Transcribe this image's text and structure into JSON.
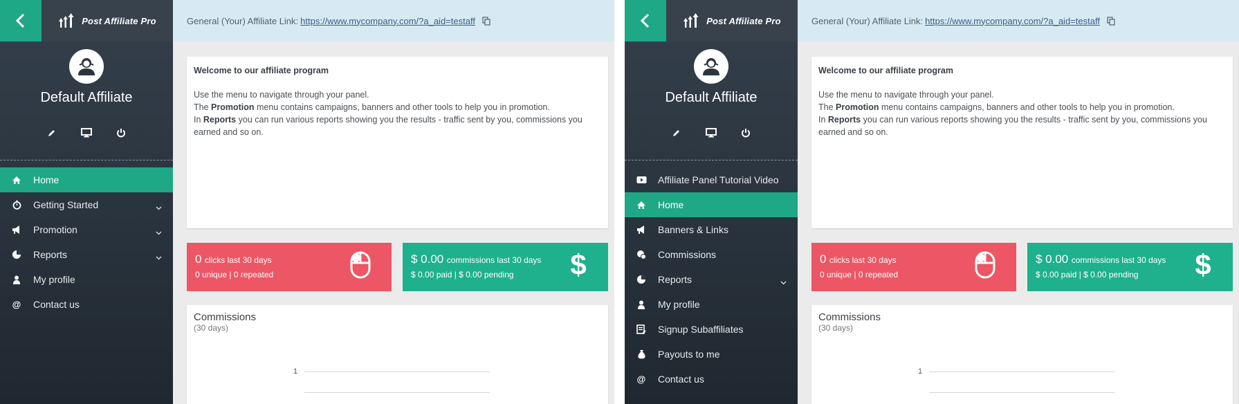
{
  "brand": "Post Affiliate Pro",
  "user_name": "Default Affiliate",
  "link_bar": {
    "label": "General (Your) Affiliate Link:",
    "url": "https://www.mycompany.com/?a_aid=testaff"
  },
  "welcome": {
    "title": "Welcome to our affiliate program",
    "line1": "Use the menu to navigate through your panel.",
    "line2_pre": "The ",
    "line2_bold": "Promotion",
    "line2_post": " menu contains campaigns, banners and other tools to help you in promotion.",
    "line3_pre": "In ",
    "line3_bold": "Reports",
    "line3_post": " you can run various reports showing you the results - traffic sent by you, commissions you earned and so on."
  },
  "stats": {
    "clicks_value": "0",
    "clicks_label": "clicks last 30 days",
    "clicks_sub": "0 unique | 0 repeated",
    "comm_value": "$ 0.00",
    "comm_label": "commissions last 30 days",
    "comm_sub": "$ 0.00 paid | $ 0.00 pending"
  },
  "commissions": {
    "title": "Commissions",
    "subtitle": "(30 days)",
    "tick": "1"
  },
  "left_nav": [
    {
      "label": "Home",
      "icon": "home-icon",
      "active": true,
      "chevron": false
    },
    {
      "label": "Getting Started",
      "icon": "stopwatch-icon",
      "active": false,
      "chevron": true
    },
    {
      "label": "Promotion",
      "icon": "megaphone-icon",
      "active": false,
      "chevron": true
    },
    {
      "label": "Reports",
      "icon": "pie-chart-icon",
      "active": false,
      "chevron": true
    },
    {
      "label": "My profile",
      "icon": "user-icon",
      "active": false,
      "chevron": false
    },
    {
      "label": "Contact us",
      "icon": "at-icon",
      "active": false,
      "chevron": false
    }
  ],
  "right_nav": [
    {
      "label": "Affiliate Panel Tutorial Video",
      "icon": "video-icon",
      "active": false,
      "chevron": false
    },
    {
      "label": "Home",
      "icon": "home-icon",
      "active": true,
      "chevron": false
    },
    {
      "label": "Banners & Links",
      "icon": "megaphone-icon",
      "active": false,
      "chevron": false
    },
    {
      "label": "Commissions",
      "icon": "coins-icon",
      "active": false,
      "chevron": false
    },
    {
      "label": "Reports",
      "icon": "pie-chart-icon",
      "active": false,
      "chevron": true
    },
    {
      "label": "My profile",
      "icon": "user-icon",
      "active": false,
      "chevron": false
    },
    {
      "label": "Signup Subaffiliates",
      "icon": "signup-icon",
      "active": false,
      "chevron": false
    },
    {
      "label": "Payouts to me",
      "icon": "money-bag-icon",
      "active": false,
      "chevron": false
    },
    {
      "label": "Contact us",
      "icon": "at-icon",
      "active": false,
      "chevron": false
    }
  ],
  "colors": {
    "accent": "#1fa886",
    "sidebar": "#2b3540",
    "link_bar": "#d7eaf3",
    "red_stat": "#ec5665",
    "green_stat": "#1fb08d"
  }
}
